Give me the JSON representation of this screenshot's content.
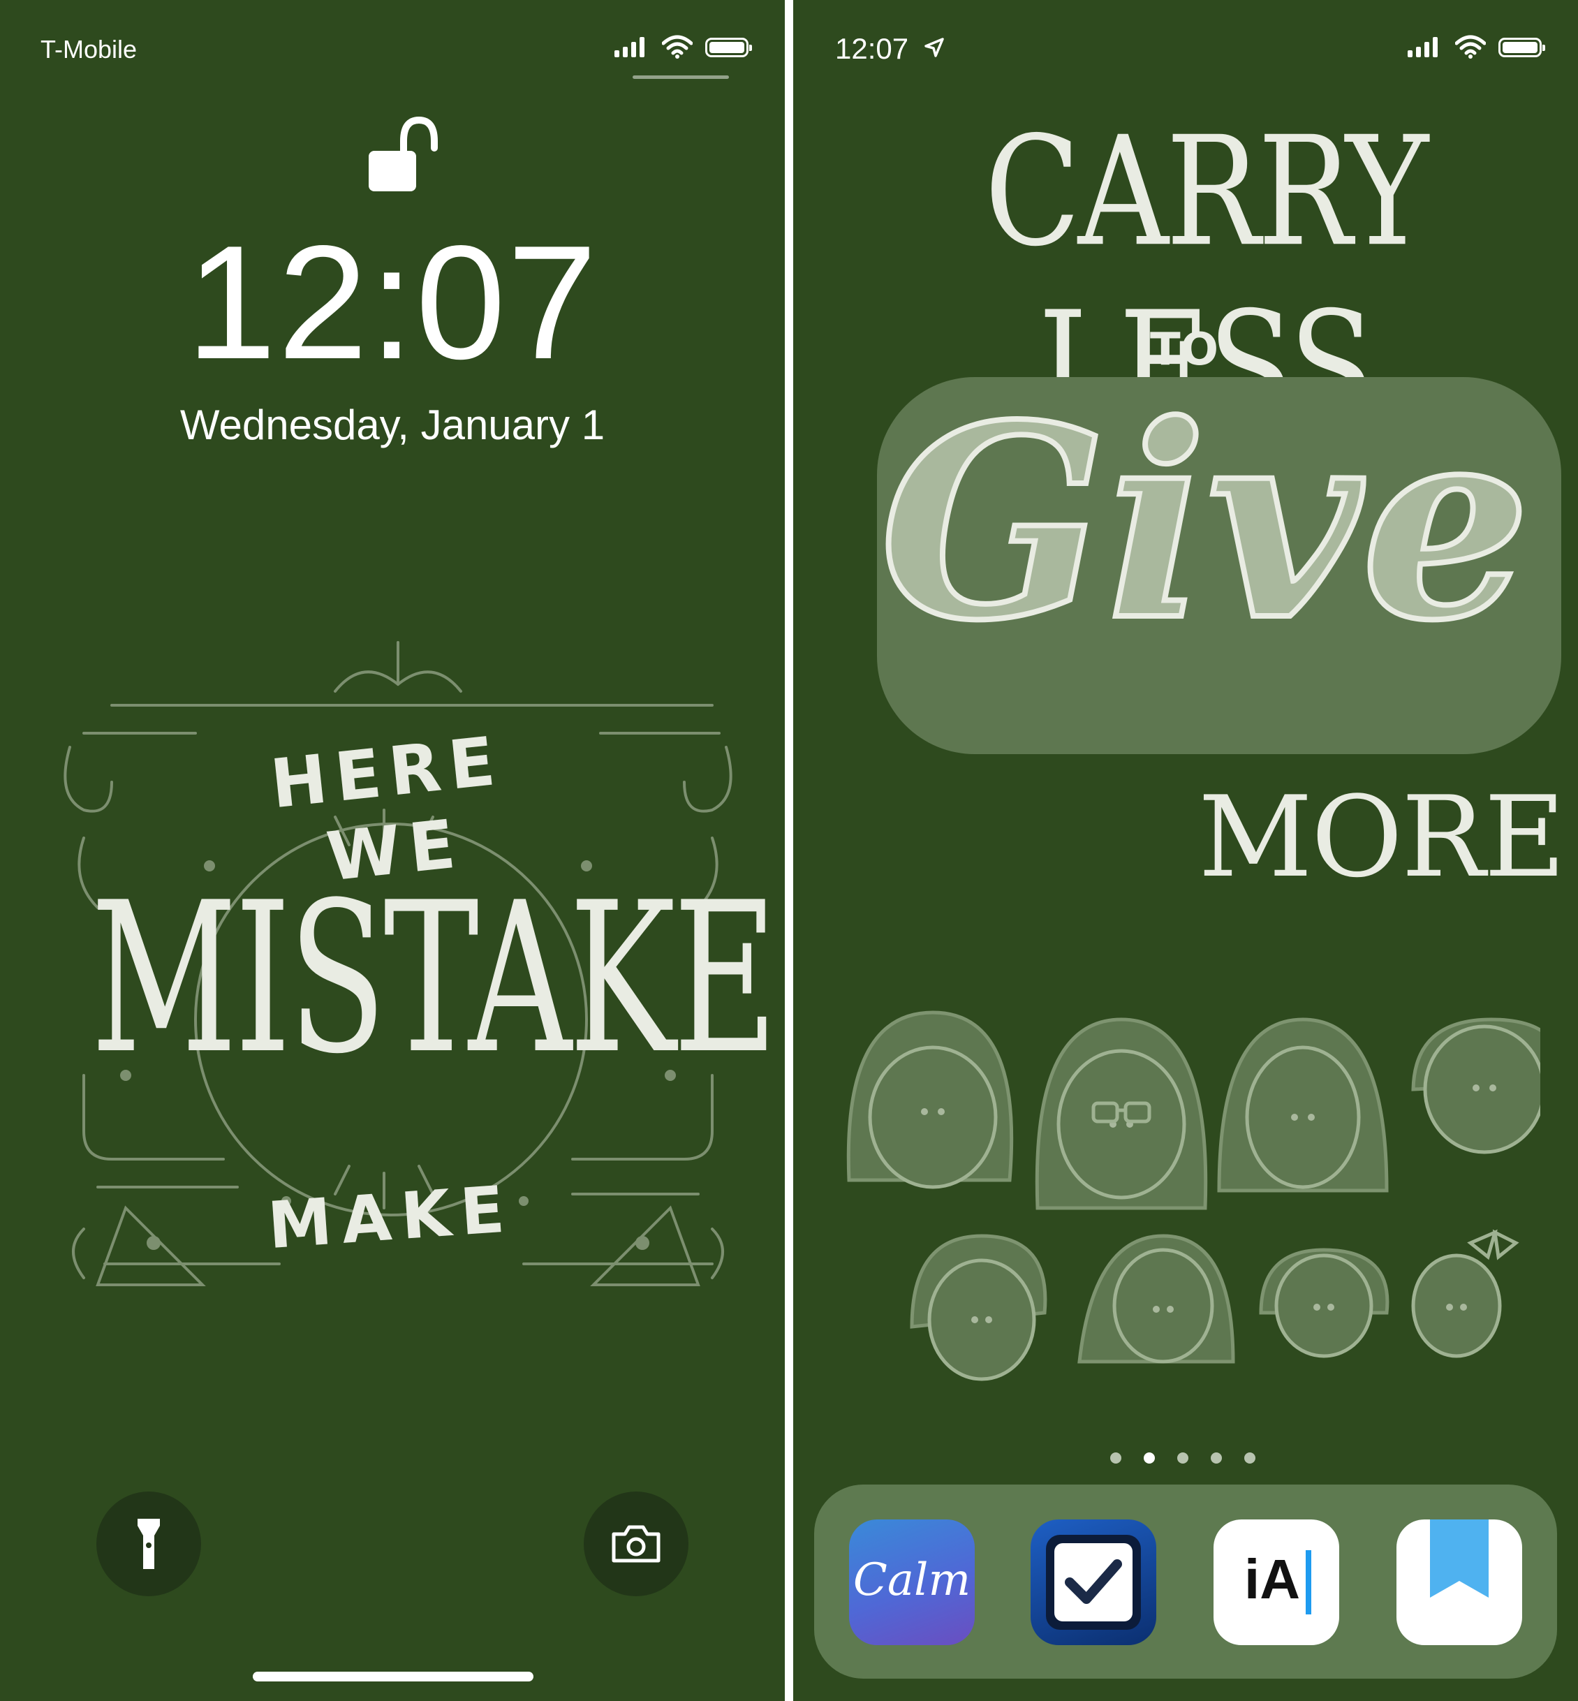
{
  "lock_screen": {
    "status_bar": {
      "carrier": "T-Mobile"
    },
    "time": "12:07",
    "date": "Wednesday, January 1",
    "wallpaper_text": {
      "top": "HERE WE",
      "main": "MISTAKES",
      "bottom": "MAKE"
    },
    "quick_actions": [
      {
        "name": "flashlight",
        "icon": "flashlight-icon"
      },
      {
        "name": "camera",
        "icon": "camera-icon"
      }
    ]
  },
  "home_screen": {
    "status_bar": {
      "time": "12:07"
    },
    "wallpaper_text": {
      "line1": "CARRY LESS",
      "line2": "TO",
      "line3": "Give",
      "line4": "MORE"
    },
    "page_dots": {
      "count": 5,
      "active_index": 1
    },
    "dock": [
      {
        "name": "Calm",
        "label": "Calm",
        "colors": [
          "#3a8ad8",
          "#6a4ec0"
        ]
      },
      {
        "name": "OmniFocus",
        "icon": "checkbox-icon",
        "colors": [
          "#1e5fc4",
          "#0b2f70"
        ]
      },
      {
        "name": "iA Writer",
        "label": "iA",
        "cursor_color": "#1e9bf0"
      },
      {
        "name": "Bookmarks",
        "icon": "bookmark-icon",
        "color": "#4fb2f0"
      }
    ]
  }
}
